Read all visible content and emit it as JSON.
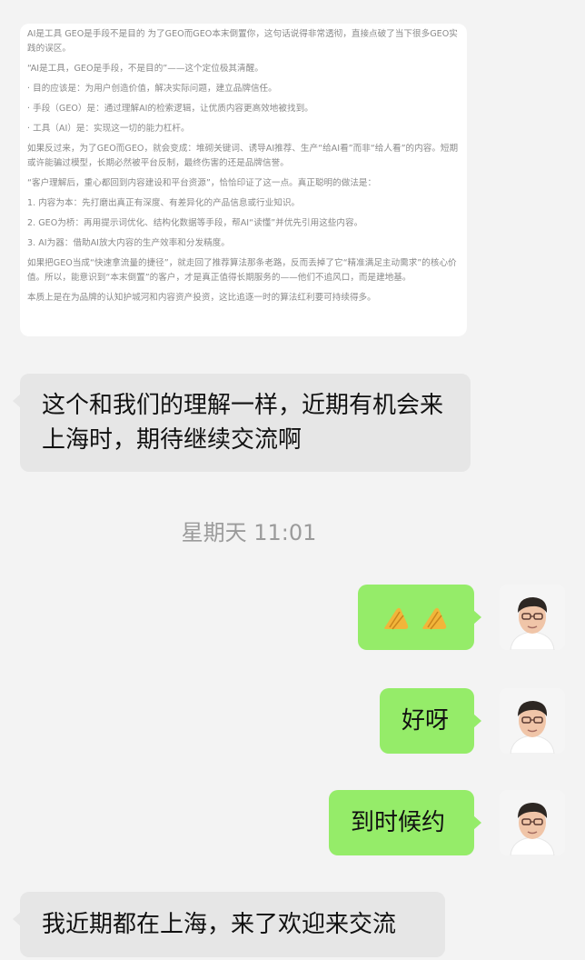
{
  "quote_card": {
    "paragraphs": [
      "AI是工具 GEO是手段不是目的  为了GEO而GEO本末倒置你，这句话说得非常透彻，直接点破了当下很多GEO实践的误区。",
      "“AI是工具，GEO是手段，不是目的”——这个定位极其清醒。",
      "· 目的应该是：为用户创造价值，解决实际问题，建立品牌信任。",
      "· 手段（GEO）是：通过理解AI的检索逻辑，让优质内容更高效地被找到。",
      "· 工具（AI）是：实现这一切的能力杠杆。",
      "如果反过来，为了GEO而GEO，就会变成：堆砌关键词、诱导AI推荐、生产“给AI看”而非“给人看”的内容。短期或许能骗过模型，长期必然被平台反制，最终伤害的还是品牌信誉。",
      "“客户理解后，重心都回到内容建设和平台资源”，恰恰印证了这一点。真正聪明的做法是：",
      "1. 内容为本：先打磨出真正有深度、有差异化的产品信息或行业知识。",
      "2. GEO为桥：再用提示词优化、结构化数据等手段，帮AI“读懂”并优先引用这些内容。",
      "3. AI为器：借助AI放大内容的生产效率和分发精度。",
      "如果把GEO当成“快速拿流量的捷径”，就走回了推荐算法那条老路，反而丢掉了它“精准满足主动需求”的核心价值。所以，能意识到“本末倒置”的客户，才是真正值得长期服务的——他们不追风口，而是建地基。",
      "本质上是在为品牌的认知护城河和内容资产投资，这比追逐一时的算法红利要可持续得多。"
    ]
  },
  "messages": {
    "left_1": "这个和我们的理解一样，近期有机会来上海时，期待继续交流啊",
    "timestamp": "星期天 11:01",
    "right_1": "🙏🙏",
    "right_2": "好呀",
    "right_3": "到时候约",
    "left_2": "我近期都在上海，来了欢迎来交流"
  },
  "colors": {
    "background": "#f3f3f3",
    "incoming_bubble": "#e6e6e6",
    "outgoing_bubble": "#95ec69"
  }
}
